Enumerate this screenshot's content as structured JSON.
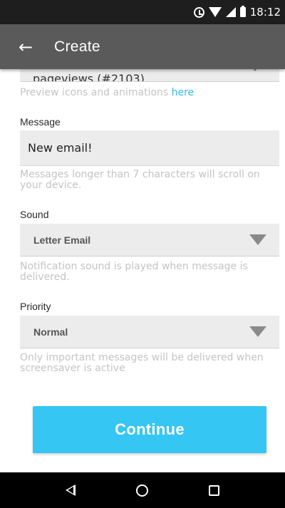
{
  "status_bar": {
    "time": "18:12",
    "icons": [
      "alarm-icon",
      "wifi-icon",
      "signal-icon",
      "battery-icon"
    ]
  },
  "app_bar": {
    "back_icon": "arrow-left-icon",
    "back_glyph": "←",
    "title": "Create"
  },
  "top_select": {
    "value": "pageviews (#2103)"
  },
  "preview_hint": {
    "text": "Preview icons and animations ",
    "link": "here"
  },
  "message": {
    "label": "Message",
    "value": "New email!",
    "hint": "Messages longer than 7 characters will scroll on your device."
  },
  "sound": {
    "label": "Sound",
    "value": "Letter Email",
    "hint": "Notification sound is played when message is delivered."
  },
  "priority": {
    "label": "Priority",
    "value": "Normal",
    "hint": "Only important messages will be delivered when screensaver is active"
  },
  "continue_button": {
    "label": "Continue"
  },
  "nav_bar": {
    "icons": [
      "back-triangle-icon",
      "home-circle-icon",
      "recents-square-icon"
    ]
  },
  "colors": {
    "accent": "#35c6f4",
    "link": "#35b8e6",
    "app_bar": "#5a5a5a",
    "status_bar": "#1e1e1e"
  }
}
